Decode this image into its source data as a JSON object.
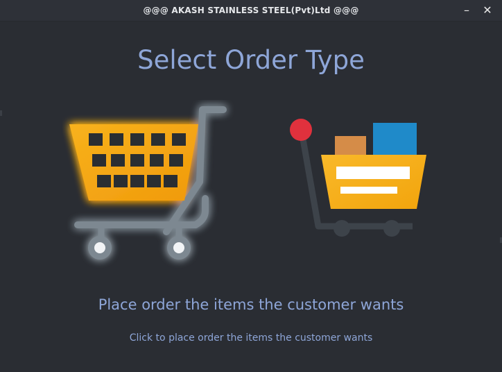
{
  "window": {
    "title": "@@@ AKASH STAINLESS STEEL(Pvt)Ltd @@@",
    "minimize_symbol": "–",
    "close_symbol": "✕"
  },
  "main": {
    "heading": "Select Order Type",
    "options": [
      {
        "name": "regular-order",
        "icon": "shopping-cart-icon"
      },
      {
        "name": "bulk-order",
        "icon": "trolley-cart-icon"
      }
    ],
    "description": "Place order the items the customer wants",
    "hint": "Click to place order the items the customer wants"
  },
  "colors": {
    "background": "#2a2d33",
    "titlebar": "#2e3138",
    "accent_text": "#8ea6d8",
    "cart_yellow": "#f6a714",
    "cart_grey": "#7d8891",
    "glow": "#fff6d0",
    "box_orange": "#d58c48",
    "box_blue": "#1f8ac9",
    "handle_red": "#e0313d"
  }
}
